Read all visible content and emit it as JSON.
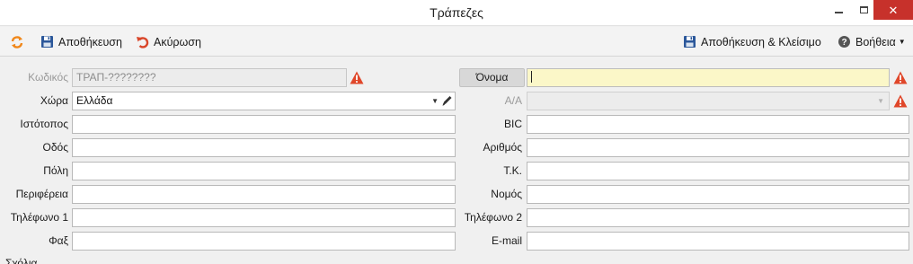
{
  "window": {
    "title": "Τράπεζες",
    "minimize": "minimize",
    "maximize": "maximize",
    "close": "close"
  },
  "toolbar": {
    "refresh_icon": "refresh-icon",
    "save_label": "Αποθήκευση",
    "cancel_label": "Ακύρωση",
    "save_close_label": "Αποθήκευση & Κλείσιμο",
    "help_label": "Βοήθεια"
  },
  "form": {
    "code": {
      "label": "Κωδικός",
      "value": "ΤΡΑΠ-????????"
    },
    "name": {
      "label": "Όνομα",
      "value": ""
    },
    "country": {
      "label": "Χώρα",
      "value": "Ελλάδα"
    },
    "aa": {
      "label": "Α/Α",
      "value": ""
    },
    "website": {
      "label": "Ιστότοπος",
      "value": ""
    },
    "bic": {
      "label": "BIC",
      "value": ""
    },
    "street": {
      "label": "Οδός",
      "value": ""
    },
    "number": {
      "label": "Αριθμός",
      "value": ""
    },
    "city": {
      "label": "Πόλη",
      "value": ""
    },
    "postal": {
      "label": "Τ.Κ.",
      "value": ""
    },
    "region": {
      "label": "Περιφέρεια",
      "value": ""
    },
    "prefecture": {
      "label": "Νομός",
      "value": ""
    },
    "phone1": {
      "label": "Τηλέφωνο 1",
      "value": ""
    },
    "phone2": {
      "label": "Τηλέφωνο 2",
      "value": ""
    },
    "fax": {
      "label": "Φαξ",
      "value": ""
    },
    "email": {
      "label": "E-mail",
      "value": ""
    },
    "comments": {
      "label": "Σχόλια"
    }
  },
  "colors": {
    "warning": "#e0472a",
    "active_field": "#fbf7c8",
    "close_button": "#c7312b",
    "accent_blue": "#2b579a",
    "refresh_orange": "#f0871a"
  }
}
